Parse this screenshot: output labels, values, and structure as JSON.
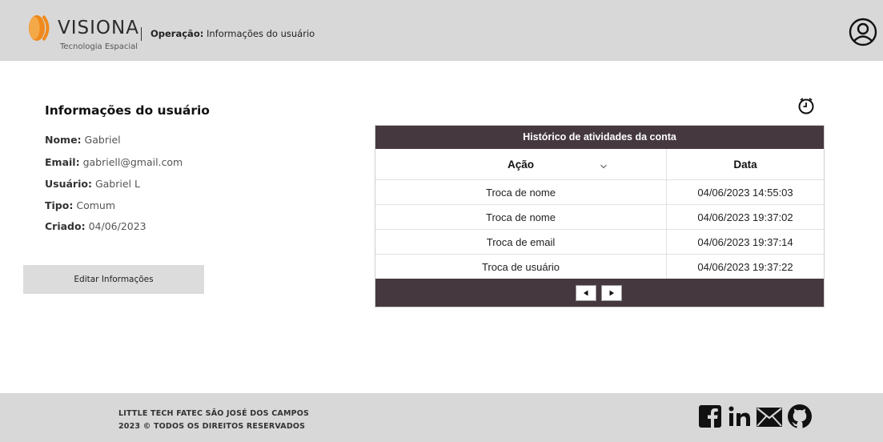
{
  "header": {
    "brand": "VISIONA",
    "brand_subtitle": "Tecnologia Espacial",
    "operation_label": "Operação:",
    "operation_value": "Informações do usuário",
    "icons": {
      "logo": "visiona-logo-icon",
      "user": "user-account-icon"
    }
  },
  "user_info": {
    "title": "Informações do usuário",
    "fields": [
      {
        "label": "Nome:",
        "value": "Gabriel"
      },
      {
        "label": "Email:",
        "value": "gabriell@gmail.com"
      },
      {
        "label": "Usuário:",
        "value": "Gabriel L"
      },
      {
        "label": "Tipo:",
        "value": "Comum"
      },
      {
        "label": "Criado:",
        "value": "04/06/2023"
      }
    ],
    "edit_button": "Editar Informações"
  },
  "activity": {
    "clock_icon": "clock-icon",
    "caption": "Histórico de atividades da conta",
    "columns": [
      "Ação",
      "Data"
    ],
    "rows": [
      [
        "Troca de nome",
        "04/06/2023 14:55:03"
      ],
      [
        "Troca de nome",
        "04/06/2023 19:37:02"
      ],
      [
        "Troca de email",
        "04/06/2023 19:37:14"
      ],
      [
        "Troca de usuário",
        "04/06/2023 19:37:22"
      ]
    ],
    "pagination": {
      "prev_icon": "triangle-left-icon",
      "next_icon": "triangle-right-icon"
    }
  },
  "footer": {
    "line1": "LITTLE TECH FATEC SÃO JOSÉ DOS CAMPOS",
    "line2": "2023 © TODOS OS DIREITOS RESERVADOS",
    "social_icons": [
      "facebook-icon",
      "linkedin-icon",
      "email-icon",
      "github-icon"
    ]
  },
  "colors": {
    "header_bg": "#d8d8d8",
    "table_header_bg": "#45383f",
    "logo_orange": "#f08a1c"
  }
}
